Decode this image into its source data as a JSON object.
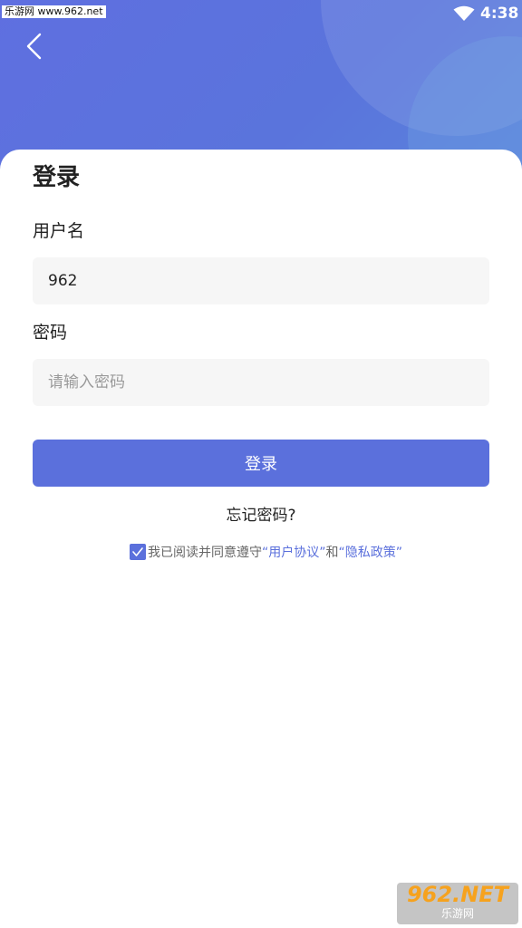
{
  "status_bar": {
    "watermark": "乐游网 www.962.net",
    "time": "4:38"
  },
  "login": {
    "title": "登录",
    "username_label": "用户名",
    "username_value": "962",
    "password_label": "密码",
    "password_placeholder": "请输入密码",
    "submit_label": "登录",
    "forgot_label": "忘记密码?"
  },
  "agreement": {
    "checked": true,
    "prefix": "我已阅读并同意遵守",
    "user_agreement": "“用户协议”",
    "conjunction": "和",
    "privacy_policy": "“隐私政策”"
  },
  "watermark_bottom": {
    "brand": "962.NET",
    "subtitle": "乐游网"
  },
  "icons": {
    "back": "back-arrow-icon",
    "wifi": "wifi-icon",
    "check": "check-icon"
  },
  "colors": {
    "header_gradient_start": "#5f6fe0",
    "header_gradient_end": "#5a84dc",
    "accent": "#5b70dc",
    "input_bg": "#f6f6f6",
    "text": "#222222",
    "muted": "#666666"
  }
}
